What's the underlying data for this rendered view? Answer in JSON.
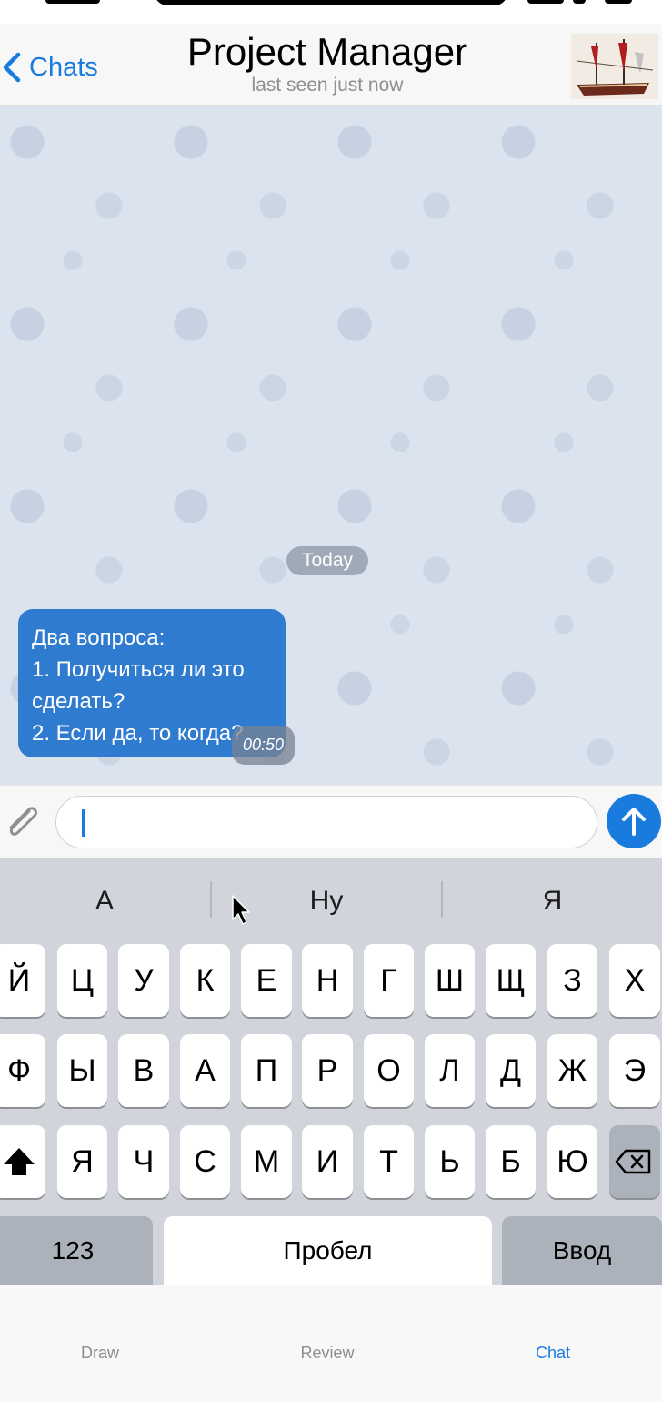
{
  "header": {
    "back_label": "Chats",
    "title": "Project Manager",
    "subtitle": "last seen just now"
  },
  "chat": {
    "date_pill": "Today",
    "message": {
      "lines": [
        "Два вопроса:",
        "1. Получиться ли это",
        "сделать?",
        "2. Если да, то когда?"
      ],
      "time": "00:50"
    }
  },
  "input": {
    "placeholder": ""
  },
  "keyboard": {
    "suggestions": [
      "А",
      "Ну",
      "Я"
    ],
    "row1": [
      "Й",
      "Ц",
      "У",
      "К",
      "Е",
      "Н",
      "Г",
      "Ш",
      "Щ",
      "З",
      "Х"
    ],
    "row2": [
      "Ф",
      "Ы",
      "В",
      "А",
      "П",
      "Р",
      "О",
      "Л",
      "Д",
      "Ж",
      "Э"
    ],
    "row3": [
      "Я",
      "Ч",
      "С",
      "М",
      "И",
      "Т",
      "Ь",
      "Б",
      "Ю"
    ],
    "numbers_label": "123",
    "space_label": "Пробел",
    "return_label": "Ввод",
    "shift_icon": "shift-icon",
    "backspace_icon": "backspace-icon"
  },
  "tabbar": {
    "tabs": [
      {
        "label": "Draw"
      },
      {
        "label": "Review"
      },
      {
        "label": "Chat"
      }
    ],
    "active": "Chat"
  },
  "colors": {
    "accent": "#1a7bde",
    "bubble": "#2f7bd0",
    "chat_background": "#dae3ee",
    "keyboard": "#d1d4db"
  },
  "icons": {
    "back": "chevron-left-icon",
    "attach": "paperclip-icon",
    "send": "arrow-up-icon",
    "avatar": "ship-image"
  }
}
